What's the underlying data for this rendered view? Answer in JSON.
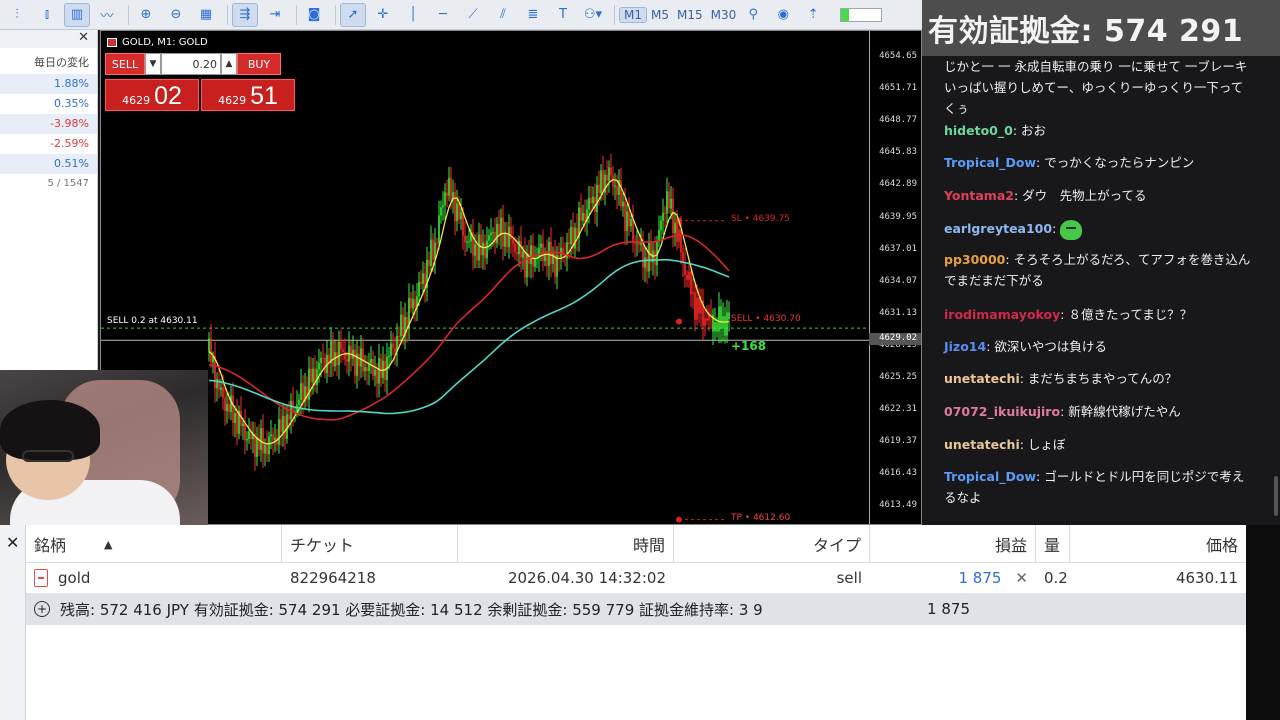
{
  "toolbar": {
    "timeframes": [
      "M1",
      "M5",
      "M15",
      "M30"
    ],
    "active_timeframe": "M1"
  },
  "market_panel": {
    "title": "毎日の変化",
    "rows": [
      {
        "value": "1.88%",
        "dir": "pos"
      },
      {
        "value": "0.35%",
        "dir": "pos"
      },
      {
        "value": "-3.98%",
        "dir": "neg"
      },
      {
        "value": "-2.59%",
        "dir": "neg"
      },
      {
        "value": "0.51%",
        "dir": "pos"
      }
    ],
    "count": "5 / 1547"
  },
  "chart": {
    "title": "GOLD, M1: GOLD",
    "trade_panel": {
      "sell_label": "SELL",
      "buy_label": "BUY",
      "lot": "0.20",
      "sell_price_small": "4629",
      "sell_price_big": "02",
      "buy_price_small": "4629",
      "buy_price_big": "51"
    },
    "position_label": "SELL 0.2 at 4630.11",
    "sl_label": "SL • 4639.75",
    "sell_label": "SELL • 4630.70",
    "tp_label": "TP • 4612.60",
    "profit_label": "+168",
    "current_price": "4629.02",
    "price_axis": [
      "4654.65",
      "4651.71",
      "4648.77",
      "4645.83",
      "4642.89",
      "4639.95",
      "4637.01",
      "4634.07",
      "4631.13",
      "4628.19",
      "4625.25",
      "4622.31",
      "4619.37",
      "4616.43",
      "4613.49"
    ],
    "colors": {
      "bull": "#3ef03e",
      "bear": "#ff2a2a",
      "fast_ma": "#f5e84a",
      "mid_ma": "#d8262b",
      "slow_ma": "#4fd8c8"
    }
  },
  "chat": {
    "header": "有効証拠金: 574 291",
    "messages": [
      {
        "user": "",
        "color": "#efeff1",
        "text": "じかと一 一 永成自転車の乗り 一に乗せて 一ブレーキいっぱい握りしめてー、ゆっくりーゆっくり一下ってくぅ"
      },
      {
        "user": "hideto0_0",
        "color": "#6ed69e",
        "text": "おお"
      },
      {
        "user": "Tropical_Dow",
        "color": "#5b9cf5",
        "text": "でっかくなったらナンピン"
      },
      {
        "user": "Yontama2",
        "color": "#e0405a",
        "text": "ダウ　先物上がってる"
      },
      {
        "user": "earlgreytea100",
        "color": "#8fb8f0",
        "text": "",
        "emote": "cat-emote"
      },
      {
        "user": "pp30000",
        "color": "#e8a13c",
        "text": "そろそろ上がるだろ、てアフォを巻き込んでまだまだ下がる"
      },
      {
        "user": "irodimamayokoy",
        "color": "#d0284a",
        "text": "８億きたってまじ？？"
      },
      {
        "user": "Jizo14",
        "color": "#5b8cf0",
        "text": "欲深いやつは負ける"
      },
      {
        "user": "unetatechi",
        "color": "#e8c79a",
        "text": "まだちまちまやってんの？"
      },
      {
        "user": "07072_ikuikujiro",
        "color": "#e07aa0",
        "text": "新幹線代稼げたやん"
      },
      {
        "user": "unetatechi",
        "color": "#e8c79a",
        "text": "しょぼ"
      },
      {
        "user": "Tropical_Dow",
        "color": "#5b9cf5",
        "text": "ゴールドとドル円を同じポジで考えるなよ"
      }
    ]
  },
  "toolbox": {
    "headers": {
      "symbol": "銘柄",
      "ticket": "チケット",
      "time": "時間",
      "type": "タイプ",
      "profit": "損益",
      "volume": "量",
      "price": "価格"
    },
    "row": {
      "symbol": "gold",
      "ticket": "822964218",
      "time": "2026.04.30 14:32:02",
      "type": "sell",
      "profit": "1 875",
      "volume": "0.2",
      "price": "4630.11"
    },
    "summary": "残高: 572 416 JPY  有効証拠金: 574 291  必要証拠金: 14 512  余剰証拠金: 559 779  証拠金維持率: 3 9",
    "summary_profit": "1 875"
  }
}
